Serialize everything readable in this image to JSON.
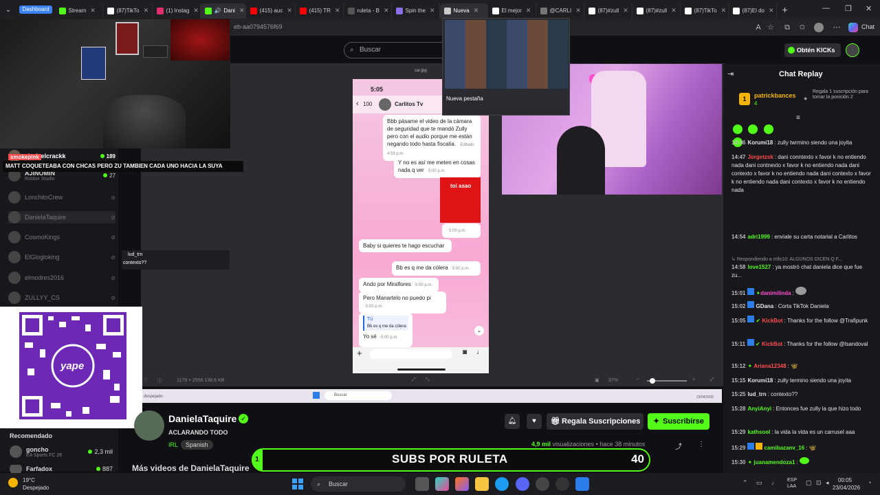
{
  "browser": {
    "tabs": [
      {
        "label": "Dashboard",
        "color": "#3b82f6"
      },
      {
        "label": "Stream",
        "color": "#53fc18"
      },
      {
        "label": "(87)TikTo",
        "color": "#ffffff"
      },
      {
        "label": "(1) Instag",
        "color": "#e1306c"
      },
      {
        "label": "Dani",
        "color": "#53fc18"
      },
      {
        "label": "(415) auc",
        "color": "#ff0000"
      },
      {
        "label": "(415) TR",
        "color": "#ff0000"
      },
      {
        "label": "ruleta - B",
        "color": "#888888"
      },
      {
        "label": "Spin the",
        "color": "#8a6fe8"
      },
      {
        "label": "Nueva",
        "color": "#cccccc"
      },
      {
        "label": "El mejor",
        "color": "#ffffff"
      },
      {
        "label": "@CARLI",
        "color": "#888888"
      },
      {
        "label": "(87)#zull",
        "color": "#ffffff"
      },
      {
        "label": "(87)#zull",
        "color": "#ffffff"
      },
      {
        "label": "(87)TikTo",
        "color": "#ffffff"
      },
      {
        "label": "(87)El do",
        "color": "#ffffff"
      }
    ],
    "url": "eb-aa0794576f69",
    "profile_label": "Chat",
    "tab_preview_label": "Nueva pestaña"
  },
  "search_placeholder": "Buscar",
  "kicks_button": "Obtén KICKs",
  "overlay": {
    "banner": "MATT COQUETEABA CON CHCAS PERO ZU TAMBIEN CADA UNO HACIA LA SUYA",
    "tag_smoke": "smokepink",
    "lud_name": "lud_trn",
    "lud_msg": "contexto??"
  },
  "sidebar": {
    "top": {
      "name": "chafeelcrackk",
      "count": "189"
    },
    "items": [
      {
        "name": "AJINOMIN",
        "sub": "Roblox Studio",
        "count": "27"
      },
      {
        "name": "LonchitoCrew",
        "sub": ""
      },
      {
        "name": "DanielaTaquire",
        "sub": ""
      },
      {
        "name": "CosmoKings",
        "sub": ""
      },
      {
        "name": "ElGlogloking",
        "sub": ""
      },
      {
        "name": "elmodres2016",
        "sub": ""
      },
      {
        "name": "ZULLYY_CS",
        "sub": ""
      }
    ],
    "recommended_title": "Recomendado",
    "recommended": [
      {
        "name": "goncho",
        "game": "EA Sports FC 26",
        "views": "2,3 mil"
      },
      {
        "name": "Farfadox",
        "game": "",
        "views": "887"
      }
    ]
  },
  "phone": {
    "filename": "car.jpg",
    "time": "5:05",
    "back_count": "100",
    "contact": "Carlitos Tv",
    "messages": [
      {
        "text": "Bbb pásame el video de la cámara de seguridad que te mandó Zully pero con el audio porque me están negando todo hasta fiscalía.",
        "time": "Editado 4:59 p.m."
      },
      {
        "text": "Y no es así me meten en cosas nada q ver",
        "time": "5:00 p.m."
      },
      {
        "text": "toi asao",
        "time": "5:00 p.m."
      },
      {
        "text": "Baby si quieres te hago escuchar",
        "time": ""
      },
      {
        "text": "Bb es q me da cólera",
        "time": "5:00 p.m."
      },
      {
        "text": "Ando por Miraflores",
        "time": "5:00 p.m."
      },
      {
        "text": "Pero Manartelo no puedo pi",
        "time": "5:00 p.m."
      },
      {
        "text": "Tú",
        "time": ""
      },
      {
        "text": "Bb es q me da cólera",
        "time": ""
      },
      {
        "text": "Yo sé",
        "time": "5:00 p.m."
      }
    ]
  },
  "share": {
    "meta_left": "1179 × 2556   138,6 KB",
    "zoom": "37%",
    "weather": "despejado",
    "search": "Buscar",
    "date": "23/04/2026"
  },
  "channel": {
    "name": "DanielaTaquire",
    "title": "ACLARANDO TODO",
    "category": "IRL",
    "language": "Spanish",
    "views": "4,9 mil",
    "views_suffix": "visualizaciones",
    "ago": "hace 38 minutos",
    "gift_label": "Regala Suscripciones",
    "subscribe_label": "Suscribirse",
    "more_videos": "Más videos de DanielaTaquire"
  },
  "ruleta": {
    "text": "SUBS POR RULETA",
    "count": "40",
    "left_num": "1"
  },
  "chat": {
    "title": "Chat Replay",
    "gifter": {
      "name": "patrickbances",
      "count": "4",
      "rank": "1",
      "note": "Regala 1 suscripción para tomar la posición 2"
    },
    "lines": [
      {
        "ts": "14:46",
        "user": "Korumi18",
        "color": "#e6e6e6",
        "msg": "zully twrmino siendo una joyita"
      },
      {
        "ts": "14:47",
        "user": "Jorgetzsk",
        "color": "#ff4d4d",
        "msg": "dani conntexto x favor k no entiendo nada dani contnexto x favor k no entiendo nada dani contexto x favor k no entiendo nada dani contexto x favor k no entiendo nada dani contexto x favor k no entiendo nada"
      },
      {
        "ts": "14:54",
        "user": "adri1999",
        "color": "#53fc18",
        "msg": "enviale su carta notarial a Carlitos"
      },
      {
        "ts": "",
        "user": "",
        "color": "#999999",
        "msg": "Respondiendo a mlls10: ALGUNOS DICEN Q F..."
      },
      {
        "ts": "14:58",
        "user": "love1527",
        "color": "#53fc18",
        "msg": "ya mostró chat daniela dice que fue zu..."
      },
      {
        "ts": "15:01",
        "user": "danimilinda",
        "color": "#ff4dd2",
        "msg": ""
      },
      {
        "ts": "15:02",
        "user": "GDana",
        "color": "#e6e6e6",
        "msg": "Corta TikTok Daniela"
      },
      {
        "ts": "15:05",
        "user": "KickBot",
        "color": "#ff4d4d",
        "msg": "Thanks for the follow @Trafipunk"
      },
      {
        "ts": "15:11",
        "user": "KickBot",
        "color": "#ff4d4d",
        "msg": "Thanks for the follow @lsandoval"
      },
      {
        "ts": "15:12",
        "user": "Ariana12348",
        "color": "#ff4d4d",
        "msg": ""
      },
      {
        "ts": "15:15",
        "user": "Korumi18",
        "color": "#e6e6e6",
        "msg": "zully termino siendo una joyita"
      },
      {
        "ts": "15:25",
        "user": "lud_trn",
        "color": "#e6e6e6",
        "msg": "contexto??"
      },
      {
        "ts": "15:28",
        "user": "AnyiAnyi",
        "color": "#53fc18",
        "msg": "Entonces fue zully la que hizo todo"
      },
      {
        "ts": "15:29",
        "user": "kathsool",
        "color": "#53fc18",
        "msg": "la vida la vida es un carrusel aaa"
      },
      {
        "ts": "15:29",
        "user": "camibazanv_16",
        "color": "#53fc18",
        "msg": ""
      },
      {
        "ts": "15:30",
        "user": "juanamendoza1",
        "color": "#53fc18",
        "msg": ""
      }
    ]
  },
  "taskbar": {
    "weather_temp": "19°C",
    "weather_desc": "Despejado",
    "search": "Buscar",
    "lang_top": "ESP",
    "lang_bottom": "LAA",
    "time": "00:05",
    "date": "23/04/2026"
  },
  "colors": {
    "accent": "#53fc18"
  }
}
